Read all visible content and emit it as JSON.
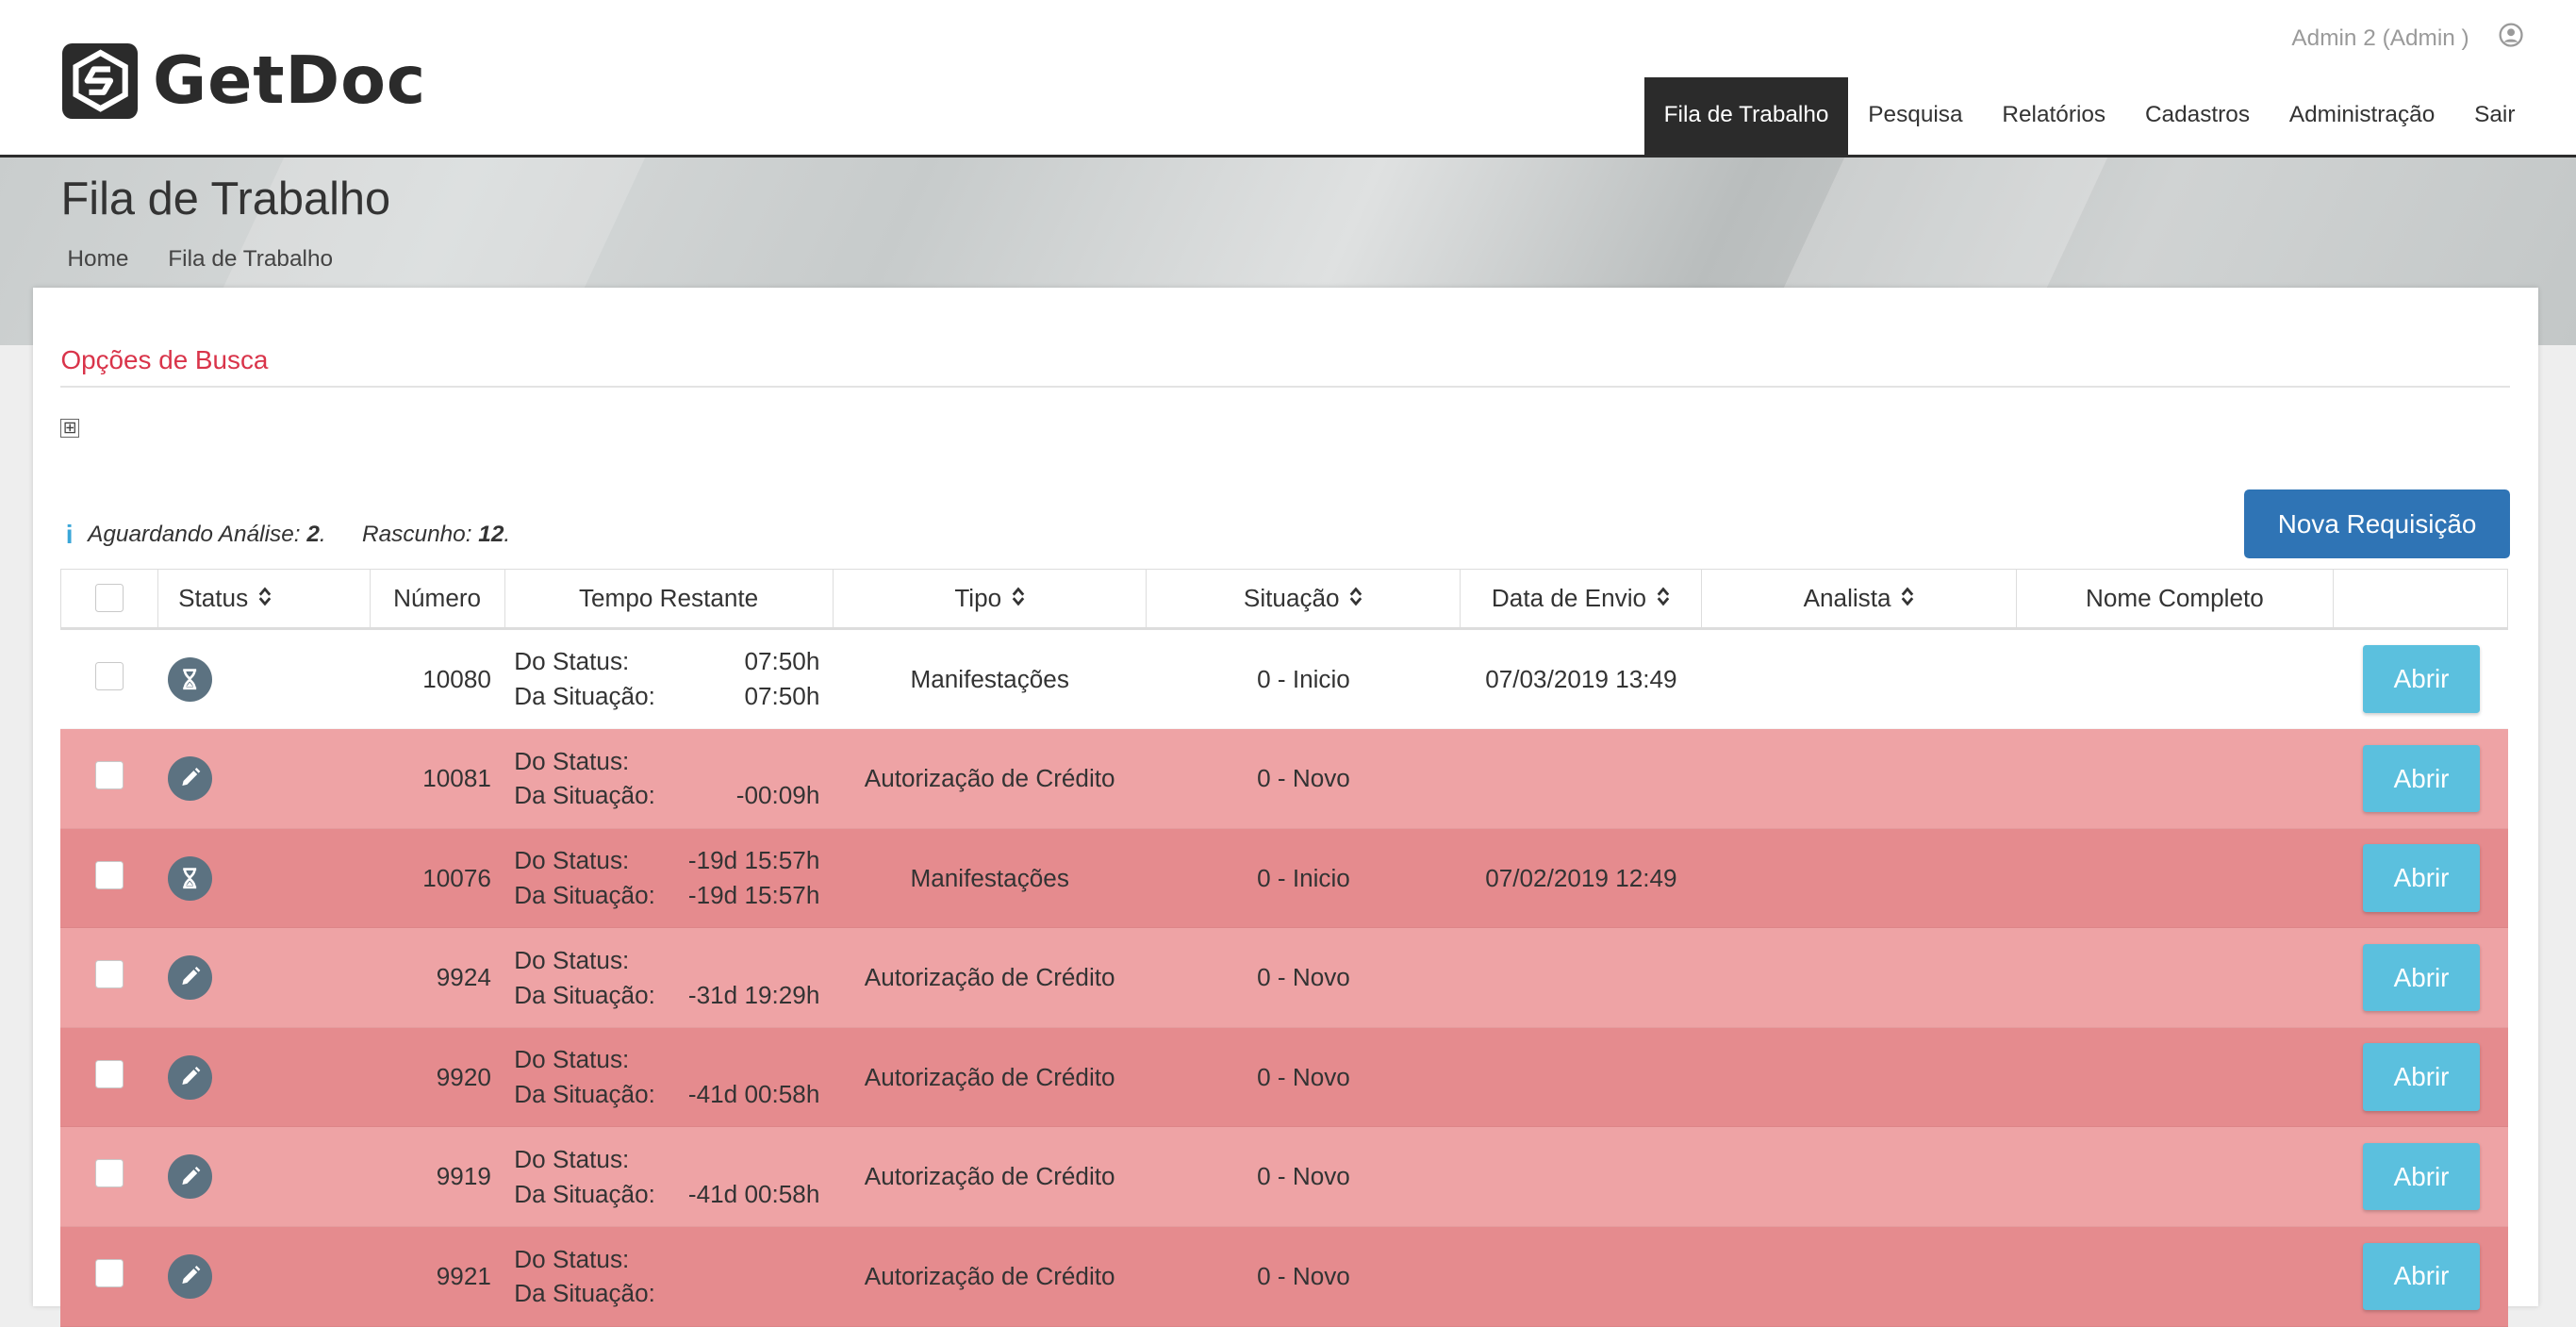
{
  "app": {
    "brand": "GetDoc",
    "user_label": "Admin 2 (Admin )"
  },
  "nav": [
    {
      "label": "Fila de Trabalho",
      "active": true
    },
    {
      "label": "Pesquisa",
      "active": false
    },
    {
      "label": "Relatórios",
      "active": false
    },
    {
      "label": "Cadastros",
      "active": false
    },
    {
      "label": "Administração",
      "active": false
    },
    {
      "label": "Sair",
      "active": false
    }
  ],
  "page": {
    "title": "Fila de Trabalho",
    "breadcrumb": [
      "Home",
      "Fila de Trabalho"
    ]
  },
  "search": {
    "title": "Opções de Busca",
    "expand_symbol": "⊞"
  },
  "summary": {
    "awaiting_label": "Aguardando Análise:",
    "awaiting_value": "2",
    "draft_label": "Rascunho:",
    "draft_value": "12"
  },
  "actions": {
    "new_request": "Nova Requisição"
  },
  "table": {
    "headers": {
      "status": "Status",
      "numero": "Número",
      "tempo": "Tempo Restante",
      "tipo": "Tipo",
      "situacao": "Situação",
      "data_envio": "Data de Envio",
      "analista": "Analista",
      "nome": "Nome Completo"
    },
    "time_labels": {
      "status": "Do Status:",
      "situacao": "Da Situação:"
    },
    "open_label": "Abrir",
    "rows": [
      {
        "icon": "hourglass-icon",
        "numero": "10080",
        "tempo_status": "07:50h",
        "tempo_situacao": "07:50h",
        "tipo": "Manifestações",
        "situacao": "0 - Inicio",
        "data_envio": "07/03/2019 13:49",
        "analista": "",
        "nome": "",
        "tone": "white"
      },
      {
        "icon": "pencil-icon",
        "numero": "10081",
        "tempo_status": "",
        "tempo_situacao": "-00:09h",
        "tipo": "Autorização de Crédito",
        "situacao": "0 - Novo",
        "data_envio": "",
        "analista": "",
        "nome": "",
        "tone": "light"
      },
      {
        "icon": "hourglass-icon",
        "numero": "10076",
        "tempo_status": "-19d 15:57h",
        "tempo_situacao": "-19d 15:57h",
        "tipo": "Manifestações",
        "situacao": "0 - Inicio",
        "data_envio": "07/02/2019 12:49",
        "analista": "",
        "nome": "",
        "tone": "dark"
      },
      {
        "icon": "pencil-icon",
        "numero": "9924",
        "tempo_status": "",
        "tempo_situacao": "-31d 19:29h",
        "tipo": "Autorização de Crédito",
        "situacao": "0 - Novo",
        "data_envio": "",
        "analista": "",
        "nome": "",
        "tone": "light"
      },
      {
        "icon": "pencil-icon",
        "numero": "9920",
        "tempo_status": "",
        "tempo_situacao": "-41d 00:58h",
        "tipo": "Autorização de Crédito",
        "situacao": "0 - Novo",
        "data_envio": "",
        "analista": "",
        "nome": "",
        "tone": "dark"
      },
      {
        "icon": "pencil-icon",
        "numero": "9919",
        "tempo_status": "",
        "tempo_situacao": "-41d 00:58h",
        "tipo": "Autorização de Crédito",
        "situacao": "0 - Novo",
        "data_envio": "",
        "analista": "",
        "nome": "",
        "tone": "light"
      },
      {
        "icon": "pencil-icon",
        "numero": "9921",
        "tempo_status": "",
        "tempo_situacao": "",
        "tipo": "Autorização de Crédito",
        "situacao": "0 - Novo",
        "data_envio": "",
        "analista": "",
        "nome": "",
        "tone": "dark"
      }
    ]
  },
  "colors": {
    "row_light": "#eea3a5",
    "row_dark": "#e58b8e",
    "primary_button": "#2f74b5",
    "open_button": "#5bc0de",
    "status_icon": "#5c7281",
    "accent_red": "#d9344a"
  }
}
